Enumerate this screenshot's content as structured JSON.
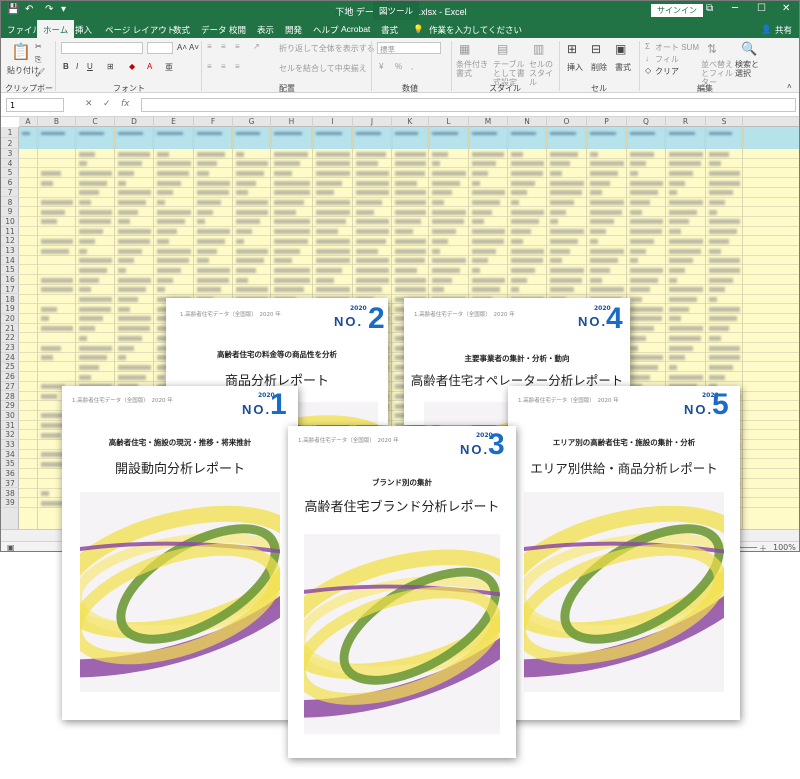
{
  "excel": {
    "title": "下地  データサンプル.xlsx  -  Excel",
    "context_tool": "図ツール",
    "signin_label": "サインイン",
    "tabs": [
      "ファイル",
      "ホーム",
      "挿入",
      "ページ レイアウト",
      "数式",
      "データ",
      "校閲",
      "表示",
      "開発",
      "ヘルプ",
      "Acrobat",
      "書式"
    ],
    "tell_me": "作業を入力してください",
    "share": "共有",
    "ribbon": {
      "paste": "貼り付け",
      "clipboard": "クリップボード",
      "font": "フォント",
      "alignment": "配置",
      "wrap": "折り返して全体を表示する",
      "merge": "セルを結合して中央揃え",
      "number_format": "標準",
      "number": "数値",
      "cond_format": "条件付き書式",
      "table_format": "テーブルとして書式設定",
      "cell_style": "セルのスタイル",
      "styles": "スタイル",
      "insert": "挿入",
      "delete": "削除",
      "format": "書式",
      "cells": "セル",
      "autosum": "オート SUM",
      "fill": "フィル",
      "clear": "クリア",
      "sort": "並べ替えとフィルター",
      "find": "検索と選択",
      "editing": "編集"
    },
    "name_box": "1",
    "fx": "fx",
    "columns": [
      "A",
      "B",
      "C",
      "D",
      "E",
      "F",
      "G",
      "H",
      "I",
      "J",
      "K",
      "L",
      "M",
      "N",
      "O",
      "P",
      "Q",
      "R",
      "S"
    ],
    "row_count": 39,
    "zoom": "100%"
  },
  "covers": [
    {
      "id": "2",
      "series": "1.高齢者住宅データ（全国版）　2020 年",
      "year": "2020",
      "no": "NO.",
      "num": "2",
      "subtitle": "高齢者住宅の料金等の商品性を分析",
      "title": "商品分析レポート"
    },
    {
      "id": "4",
      "series": "1.高齢者住宅データ（全国版）　2020 年",
      "year": "2020",
      "no": "NO.",
      "num": "4",
      "subtitle": "主要事業者の集計・分析・動向",
      "title": "高齢者住宅オペレーター分析レポート"
    },
    {
      "id": "1",
      "series": "1.高齢者住宅データ（全国版）　2020 年",
      "year": "2020",
      "no": "NO.",
      "num": "1",
      "subtitle": "高齢者住宅・施設の現況・推移・将来推計",
      "title": "開設動向分析レポート"
    },
    {
      "id": "3",
      "series": "1.高齢者住宅データ（全国版）　2020 年",
      "year": "2020",
      "no": "NO.",
      "num": "3",
      "subtitle": "ブランド別の集計",
      "title": "高齢者住宅ブランド分析レポート"
    },
    {
      "id": "5",
      "series": "1.高齢者住宅データ（全国版）　2020 年",
      "year": "2020",
      "no": "NO.",
      "num": "5",
      "subtitle": "エリア別の高齢者住宅・施設の集計・分析",
      "title": "エリア別供給・商品分析レポート"
    }
  ],
  "colors": {
    "excel_green": "#217346",
    "header_cells": "#b6e2ec",
    "data_cells": "#fffbc8",
    "report_blue": "#1a6cc8",
    "ring_yellow": "#f2e04a",
    "ring_green": "#6f9a3a",
    "ring_purple": "#8e4aa3"
  }
}
